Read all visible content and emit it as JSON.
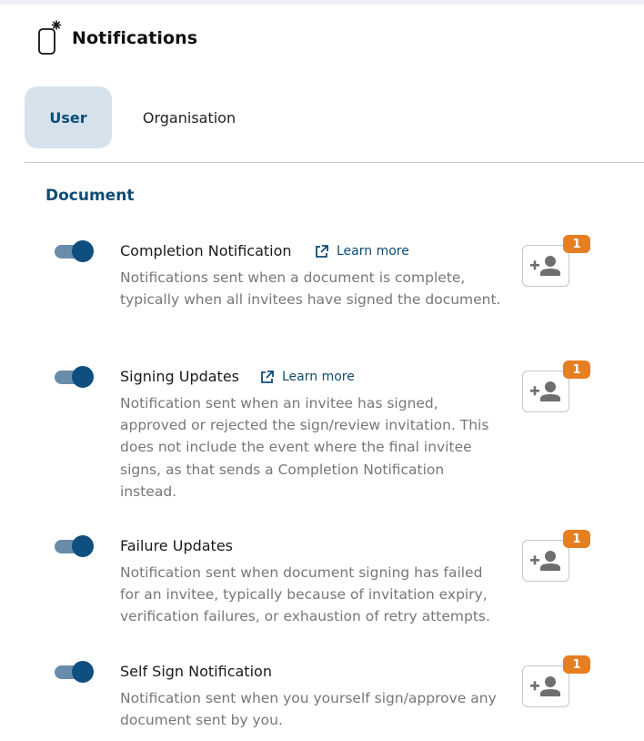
{
  "header": {
    "title": "Notifications",
    "icon": "phone-notification-icon"
  },
  "tabs": [
    {
      "label": "User",
      "active": true
    },
    {
      "label": "Organisation",
      "active": false
    }
  ],
  "section": {
    "title": "Document"
  },
  "notifications": [
    {
      "title": "Completion Notification",
      "learn_more": "Learn more",
      "description": "Notifications sent when a document is complete, typically when all invitees have signed the document.",
      "enabled": true,
      "recipients_count": "1"
    },
    {
      "title": "Signing Updates",
      "learn_more": "Learn more",
      "description": "Notification sent when an invitee has signed, approved or rejected the sign/review invitation. This does not include the event where the final invitee signs, as that sends a Completion Notification instead.",
      "enabled": true,
      "recipients_count": "1"
    },
    {
      "title": "Failure Updates",
      "description": "Notification sent when document signing has failed for an invitee, typically because of invitation expiry, verification failures, or exhaustion of retry attempts.",
      "enabled": true,
      "recipients_count": "1"
    },
    {
      "title": "Self Sign Notification",
      "description": "Notification sent when you yourself sign/approve any document sent by you.",
      "enabled": true,
      "recipients_count": "1"
    }
  ],
  "colors": {
    "accent": "#0f4c74",
    "toggle_on": "#0e4f80",
    "badge": "#e67e22",
    "tab_active_bg": "#d5e2ec"
  },
  "icons": {
    "external_link": "external-link-icon",
    "add_user": "add-user-icon"
  }
}
